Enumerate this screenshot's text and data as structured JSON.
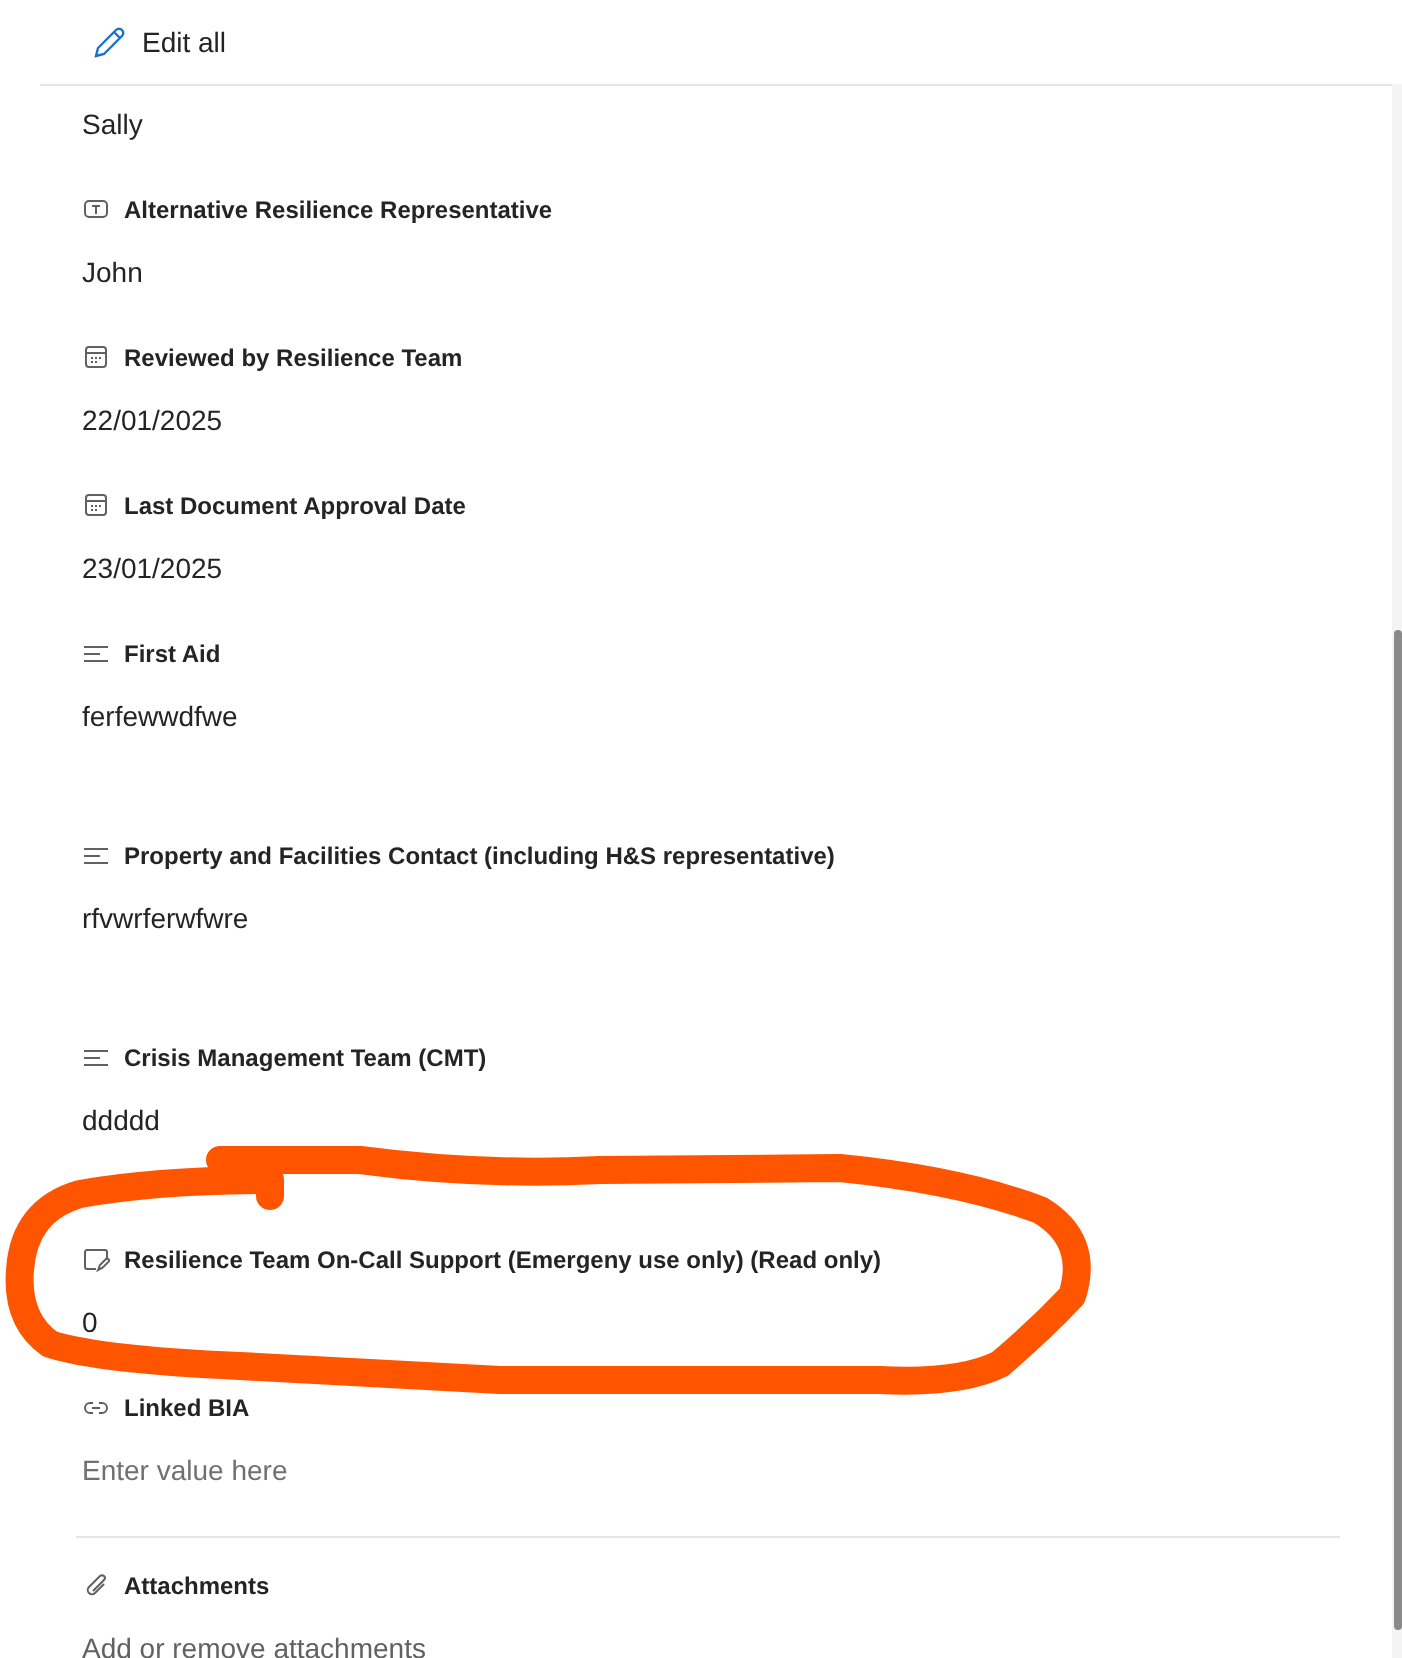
{
  "toolbar": {
    "edit_all": "Edit all"
  },
  "partial_value": "Sally",
  "fields": [
    {
      "kind": "text",
      "label": "Alternative Resilience Representative",
      "value": "John"
    },
    {
      "kind": "date",
      "label": "Reviewed by Resilience Team",
      "value": "22/01/2025"
    },
    {
      "kind": "date",
      "label": "Last Document Approval Date",
      "value": "23/01/2025"
    },
    {
      "kind": "multiline",
      "label": "First Aid",
      "value": "ferfewwdfwe"
    },
    {
      "kind": "multiline",
      "label": "Property and Facilities Contact (including H&S representative)",
      "value": "rfvwrferwfwre"
    },
    {
      "kind": "multiline",
      "label": "Crisis Management Team (CMT)",
      "value": "ddddd"
    },
    {
      "kind": "note",
      "label": "Resilience Team On-Call Support (Emergeny use only) (Read only)",
      "value": "0"
    },
    {
      "kind": "link",
      "label": "Linked BIA",
      "placeholder": "Enter value here"
    }
  ],
  "attachments": {
    "label": "Attachments",
    "placeholder": "Add or remove attachments"
  }
}
